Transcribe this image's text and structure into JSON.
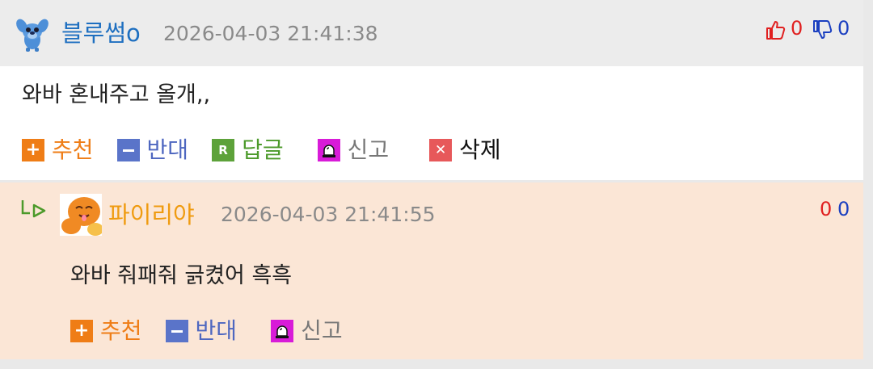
{
  "comment1": {
    "author": "블루썸o",
    "datetime": "2026-04-03 21:41:38",
    "upvotes": "0",
    "downvotes": "0",
    "text": "와바 혼내주고 올개,,",
    "actions": {
      "recommend": "추천",
      "oppose": "반대",
      "reply": "답글",
      "report": "신고",
      "delete": "삭제"
    }
  },
  "comment2": {
    "author": "파이리야",
    "datetime": "2026-04-03 21:41:55",
    "upvotes": "0",
    "downvotes": "0",
    "text": "와바 줘패줘 긁켰어 흑흑",
    "actions": {
      "recommend": "추천",
      "oppose": "반대",
      "report": "신고"
    }
  },
  "colors": {
    "author1": "#1e6fc0",
    "author2": "#ef9b10",
    "upvote": "#e02020",
    "downvote": "#1a3fc0",
    "reply_bg": "#fbe6d6"
  },
  "icons": {
    "thumbs_up": "thumbs-up-icon",
    "thumbs_down": "thumbs-down-icon",
    "reply_arrow": "reply-arrow-icon"
  }
}
